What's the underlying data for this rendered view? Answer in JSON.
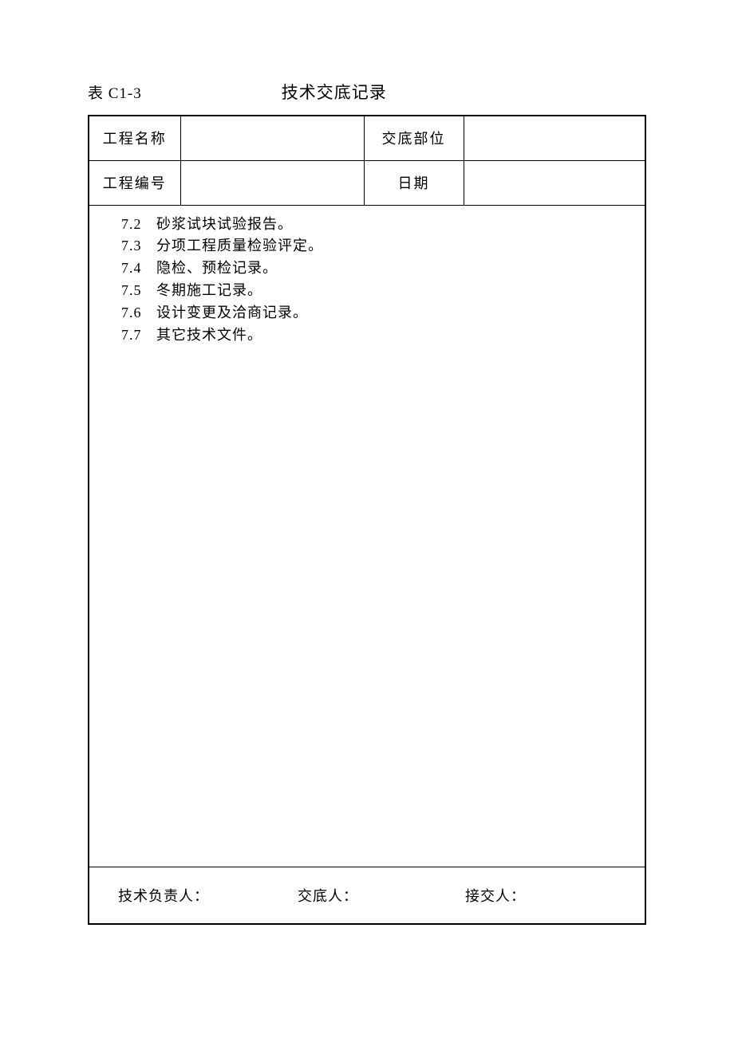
{
  "form_code": "表 C1-3",
  "form_title": "技术交底记录",
  "header": {
    "project_name_label": "工程名称",
    "project_name_value": "",
    "section_label": "交底部位",
    "section_value": "",
    "project_number_label": "工程编号",
    "project_number_value": "",
    "date_label": "日期",
    "date_value": ""
  },
  "content_items": [
    {
      "num": "7.2",
      "text": "砂浆试块试验报告。"
    },
    {
      "num": "7.3",
      "text": "分项工程质量检验评定。"
    },
    {
      "num": "7.4",
      "text": "隐检、预检记录。"
    },
    {
      "num": "7.5",
      "text": "冬期施工记录。"
    },
    {
      "num": "7.6",
      "text": "设计变更及洽商记录。"
    },
    {
      "num": "7.7",
      "text": "其它技术文件。"
    }
  ],
  "footer": {
    "tech_lead_label": "技术负责人：",
    "handover_label": "交底人：",
    "receiver_label": "接交人："
  }
}
